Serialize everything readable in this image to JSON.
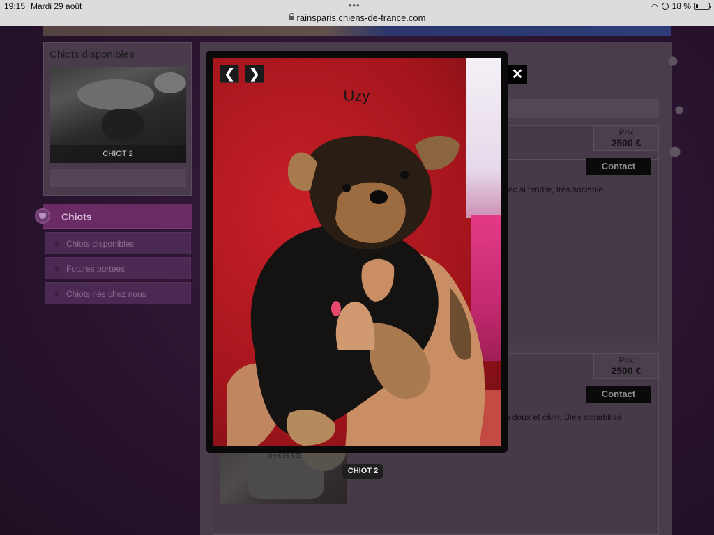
{
  "status_bar": {
    "time": "19:15",
    "date": "Mardi 29 août",
    "url": "rainsparis.chiens-de-france.com",
    "battery_pct": "18 %",
    "battery_level": 0.18
  },
  "sidebar": {
    "card_title": "Chiots disponibles",
    "card_photo_label": "CHIOT 2",
    "menu_title": "Chiots",
    "menu_items": [
      {
        "label": "Chiots disponibles"
      },
      {
        "label": "Futures portées"
      },
      {
        "label": "Chiots nés chez nous"
      }
    ]
  },
  "listings": [
    {
      "price_label": "Prix",
      "price": "2500 €",
      "contact_label": "Contact",
      "description_fragment": "mec si tendre, très sociable"
    },
    {
      "price_label": "Prix",
      "price": "2500 €",
      "contact_label": "Contact",
      "description_fragment": "es doux et câlin. Bien sociabilise"
    }
  ],
  "thumb_stamp": "Uly 6 26 8 23",
  "lightbox": {
    "caption": "Uzy",
    "badge": "CHIOT 2",
    "prev_icon": "chevron-left-icon",
    "next_icon": "chevron-right-icon",
    "close_icon": "close-icon"
  },
  "colors": {
    "overlay_dark": "#2a1430",
    "menu_accent": "#6a2a63",
    "photo_red": "#c91f28",
    "contact_bg": "#0a0a0a"
  }
}
